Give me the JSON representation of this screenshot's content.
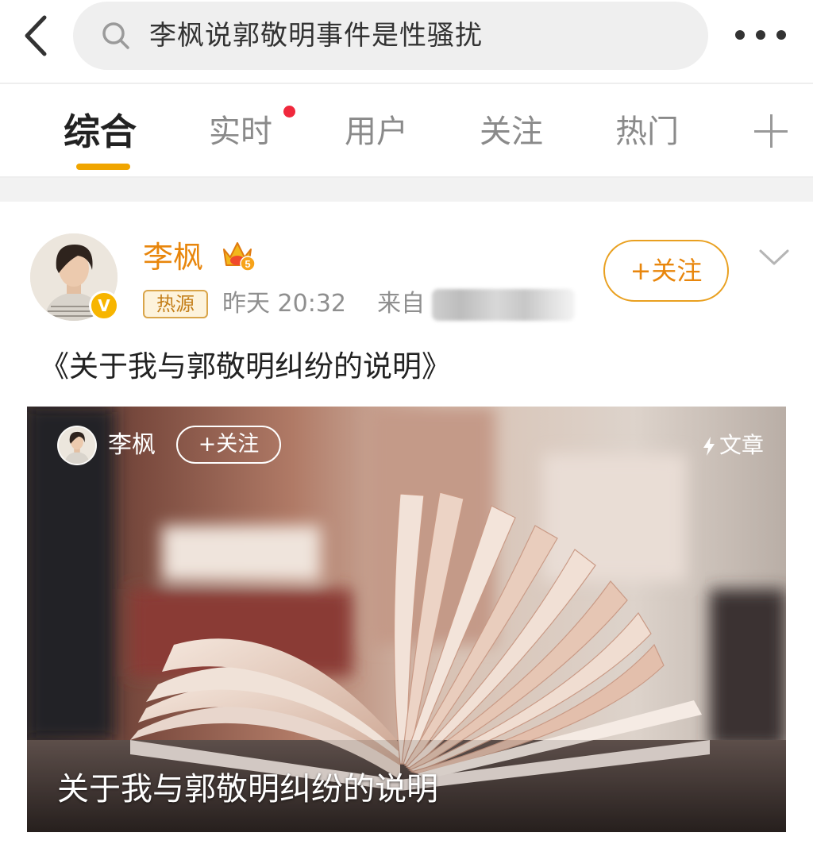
{
  "search": {
    "query": "李枫说郭敬明事件是性骚扰",
    "back_icon": "chevron-left-icon",
    "search_icon": "search-icon",
    "more_icon": "more-horizontal-icon"
  },
  "tabs": {
    "items": [
      {
        "label": "综合",
        "active": true
      },
      {
        "label": "实时",
        "has_dot": true
      },
      {
        "label": "用户"
      },
      {
        "label": "关注"
      },
      {
        "label": "热门"
      }
    ],
    "add_icon": "plus-icon"
  },
  "post": {
    "author": "李枫",
    "crown_level": "5",
    "badge": "热源",
    "time": "昨天 20:32",
    "source_prefix": "来自",
    "follow_label": "+关注",
    "title": "《关于我与郭敬明纠纷的说明》",
    "card": {
      "author": "李枫",
      "follow_label": "+关注",
      "type_label": "文章",
      "caption": "关于我与郭敬明纠纷的说明"
    }
  },
  "colors": {
    "accent": "#f0a500",
    "author_orange": "#e8860c",
    "notify_red": "#f0283c"
  }
}
